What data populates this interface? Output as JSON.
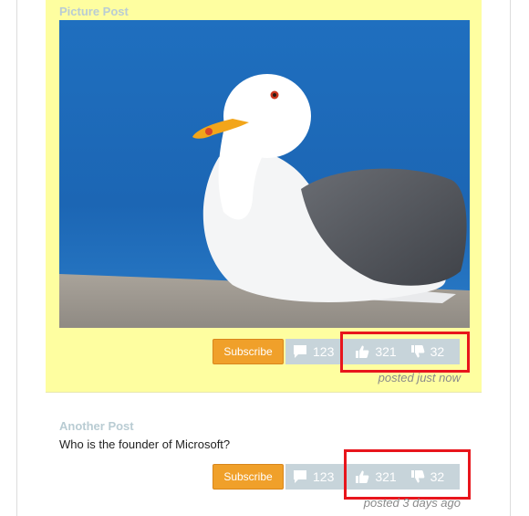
{
  "posts": [
    {
      "title": "Picture Post",
      "subscribe_label": "Subscribe",
      "comments": "123",
      "likes": "321",
      "dislikes": "32",
      "posted": "posted just now"
    },
    {
      "title": "Another Post",
      "text": "Who is the founder of Microsoft?",
      "subscribe_label": "Subscribe",
      "comments": "123",
      "likes": "321",
      "dislikes": "32",
      "posted": "posted 3 days ago"
    }
  ],
  "colors": {
    "picture_post_bg": "#fefea0",
    "title": "#b9ccd3",
    "subscribe": "#f0a02a",
    "stats_bar": "#c7d4da",
    "highlight": "#e8151c"
  },
  "icons": [
    "comment-icon",
    "thumbs-up-icon",
    "thumbs-down-icon"
  ]
}
